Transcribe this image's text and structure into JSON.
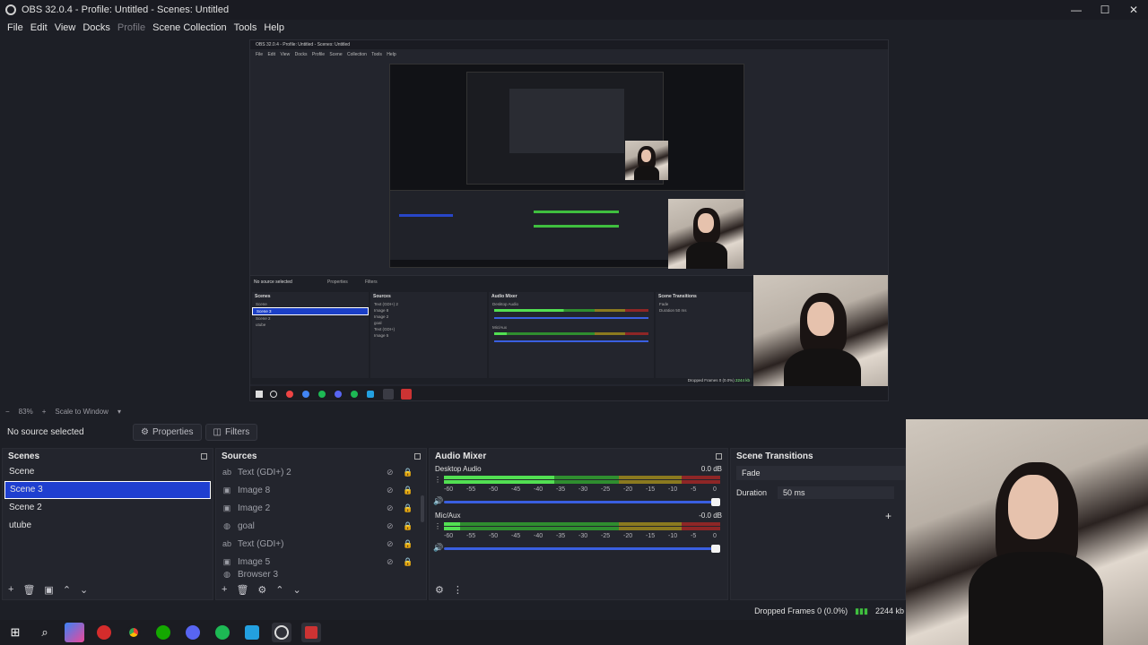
{
  "window": {
    "title": "OBS 32.0.4 - Profile: Untitled - Scenes: Untitled",
    "minimize": "—",
    "maximize": "☐",
    "close": "✕"
  },
  "menubar": {
    "items": [
      "File",
      "Edit",
      "View",
      "Docks",
      "Profile",
      "Scene Collection",
      "Tools",
      "Help"
    ]
  },
  "preview_strip": {
    "zoom_out": "−",
    "zoom": "83%",
    "zoom_in": "+",
    "scale_mode": "Scale to Window",
    "dropdown": "▾"
  },
  "source_toolbar": {
    "no_source": "No source selected",
    "properties": "Properties",
    "filters": "Filters"
  },
  "scenes": {
    "title": "Scenes",
    "items": [
      "Scene",
      "Scene 3",
      "Scene 2",
      "utube"
    ],
    "selected": "Scene 3"
  },
  "sources": {
    "title": "Sources",
    "items": [
      {
        "label": "Text (GDI+) 2",
        "icon": "text-icon"
      },
      {
        "label": "Image 8",
        "icon": "image-icon"
      },
      {
        "label": "Image 2",
        "icon": "image-icon"
      },
      {
        "label": "goal",
        "icon": "globe-icon"
      },
      {
        "label": "Text (GDI+)",
        "icon": "text-icon"
      },
      {
        "label": "Image 5",
        "icon": "image-icon"
      },
      {
        "label": "Browser 3",
        "icon": "globe-icon"
      }
    ]
  },
  "audio_mixer": {
    "title": "Audio Mixer",
    "channels": [
      {
        "name": "Desktop Audio",
        "db": "0.0 dB",
        "level": 0.4
      },
      {
        "name": "Mic/Aux",
        "db": "-0.0 dB",
        "level": 0.06
      }
    ],
    "ticks": [
      "-60",
      "-55",
      "-50",
      "-45",
      "-40",
      "-35",
      "-30",
      "-25",
      "-20",
      "-15",
      "-10",
      "-5",
      "0"
    ]
  },
  "transitions": {
    "title": "Scene Transitions",
    "type": "Fade",
    "duration_label": "Duration",
    "duration_value": "50 ms"
  },
  "status": {
    "dropped": "Dropped Frames 0 (0.0%)",
    "bitrate": "2244 kb"
  },
  "mini": {
    "title": "OBS 32.0.4 - Profile: Untitled - Scenes: Untitled",
    "menu": "File Edit View Docks Profile Scene Collection Tools Help",
    "no_source": "No source selected",
    "properties": "Properties",
    "filters": "Filters",
    "scenes_title": "Scenes",
    "sources_title": "Sources",
    "mixer_title": "Audio Mixer",
    "trans_title": "Scene Transitions",
    "scenes": [
      "Scene",
      "Scene 3",
      "Scene 2",
      "utube"
    ],
    "sources": [
      "Text (GDI+) 2",
      "Image 8",
      "Image 2",
      "goal",
      "Text (GDI+)",
      "Image 5",
      "Browser 3"
    ],
    "desktop_audio": "Desktop Audio",
    "mic": "Mic/Aux",
    "fade": "Fade",
    "duration": "Duration",
    "duration_value": "50 ms",
    "dropped": "Dropped Frames 0 (0.0%)",
    "bitrate": "2244 kb"
  },
  "taskbar": {
    "icons": [
      "windows-icon",
      "search-icon",
      "copilot-icon",
      "app-red-icon",
      "chrome-icon",
      "upwork-icon",
      "discord-icon",
      "spotify-icon",
      "vscode-icon",
      "obs-icon",
      "app-red-square-icon"
    ]
  }
}
